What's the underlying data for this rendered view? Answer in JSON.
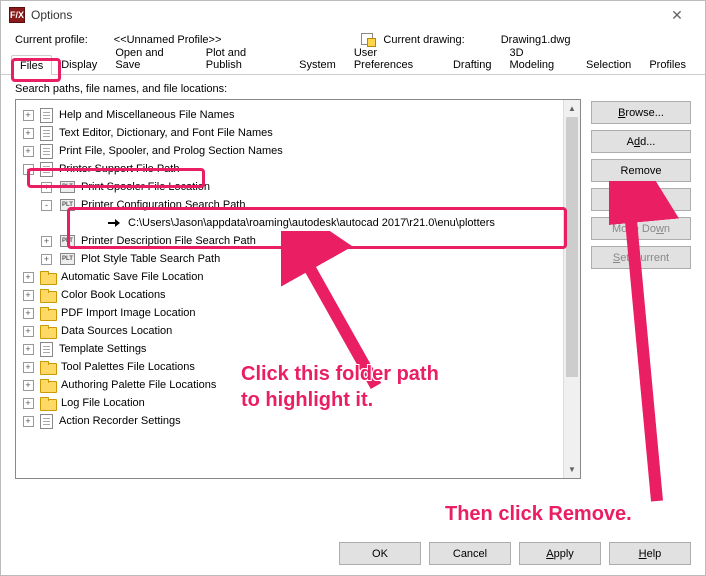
{
  "window": {
    "title": "Options"
  },
  "header": {
    "profile_label": "Current profile:",
    "profile_value": "<<Unnamed Profile>>",
    "drawing_label": "Current drawing:",
    "drawing_value": "Drawing1.dwg"
  },
  "tabs": [
    "Files",
    "Display",
    "Open and Save",
    "Plot and Publish",
    "System",
    "User Preferences",
    "Drafting",
    "3D Modeling",
    "Selection",
    "Profiles"
  ],
  "active_tab": "Files",
  "search_label": "Search paths, file names, and file locations:",
  "tree": {
    "items": [
      {
        "level": 1,
        "exp": "+",
        "icon": "doc",
        "label": "Help and Miscellaneous File Names"
      },
      {
        "level": 1,
        "exp": "+",
        "icon": "doc",
        "label": "Text Editor, Dictionary, and Font File Names"
      },
      {
        "level": 1,
        "exp": "+",
        "icon": "doc",
        "label": "Print File, Spooler, and Prolog Section Names"
      },
      {
        "level": 1,
        "exp": "-",
        "icon": "doc",
        "label": "Printer Support File Path",
        "highlight": "row-printer-support"
      },
      {
        "level": 2,
        "exp": "+",
        "icon": "plt",
        "label": "Print Spooler File Location"
      },
      {
        "level": 2,
        "exp": "-",
        "icon": "plt",
        "label": "Printer Configuration Search Path",
        "highlight": "row-config-top"
      },
      {
        "level": 3,
        "exp": "",
        "icon": "arrow",
        "label": "C:\\Users\\Jason\\appdata\\roaming\\autodesk\\autocad 2017\\r21.0\\enu\\plotters",
        "highlight": "row-config-path"
      },
      {
        "level": 2,
        "exp": "+",
        "icon": "plt",
        "label": "Printer Description File Search Path"
      },
      {
        "level": 2,
        "exp": "+",
        "icon": "plt",
        "label": "Plot Style Table Search Path"
      },
      {
        "level": 1,
        "exp": "+",
        "icon": "fld",
        "label": "Automatic Save File Location"
      },
      {
        "level": 1,
        "exp": "+",
        "icon": "fld",
        "label": "Color Book Locations"
      },
      {
        "level": 1,
        "exp": "+",
        "icon": "fld",
        "label": "PDF Import Image Location"
      },
      {
        "level": 1,
        "exp": "+",
        "icon": "fld",
        "label": "Data Sources Location"
      },
      {
        "level": 1,
        "exp": "+",
        "icon": "doc",
        "label": "Template Settings"
      },
      {
        "level": 1,
        "exp": "+",
        "icon": "fld",
        "label": "Tool Palettes File Locations"
      },
      {
        "level": 1,
        "exp": "+",
        "icon": "fld",
        "label": "Authoring Palette File Locations"
      },
      {
        "level": 1,
        "exp": "+",
        "icon": "fld",
        "label": "Log File Location"
      },
      {
        "level": 1,
        "exp": "+",
        "icon": "doc",
        "label": "Action Recorder Settings"
      }
    ]
  },
  "side_buttons": {
    "browse": "Browse...",
    "add": "Add...",
    "remove": "Remove",
    "move_up": "Move Up",
    "move_down": "Move Down",
    "set_current": "Set Current"
  },
  "bottom_buttons": {
    "ok": "OK",
    "cancel": "Cancel",
    "apply": "Apply",
    "help": "Help"
  },
  "annotations": {
    "click_path": "Click this folder path\nto highlight it.",
    "click_remove": "Then click Remove."
  }
}
